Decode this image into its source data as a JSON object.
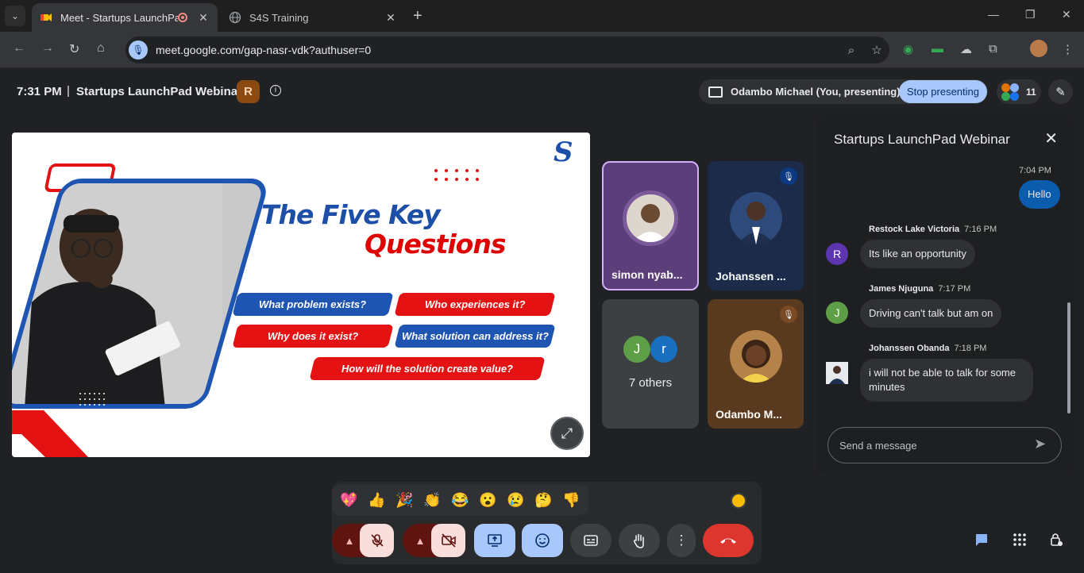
{
  "browser": {
    "tabs": [
      {
        "title": "Meet - Startups LaunchPad",
        "active": true
      },
      {
        "title": "S4S Training",
        "active": false
      }
    ],
    "url": "meet.google.com/gap-nasr-vdk?authuser=0"
  },
  "header": {
    "time": "7:31 PM",
    "separator": "|",
    "meeting_title": "Startups LaunchPad Webinar",
    "host_badge": "R",
    "presenting_label": "Odambo Michael (You, presenting)",
    "stop_presenting": "Stop presenting",
    "participant_count": "11"
  },
  "slide": {
    "title_line1": "The Five Key",
    "title_line2": "Questions",
    "questions": [
      "What problem exists?",
      "Who experiences it?",
      "Why does it exist?",
      "What solution can address it?",
      "How will the solution create value?"
    ]
  },
  "tiles": [
    {
      "name": "simon nyab...",
      "active_speaker": true
    },
    {
      "name": "Johanssen ...",
      "muted": true
    },
    {
      "name": "7 others",
      "letters": [
        "J",
        "r"
      ]
    },
    {
      "name": "Odambo M...",
      "muted": true
    }
  ],
  "chat": {
    "title": "Startups LaunchPad Webinar",
    "messages": [
      {
        "sender": "",
        "time": "7:04 PM",
        "text": "Hello",
        "self": true
      },
      {
        "sender": "Restock Lake Victoria",
        "initial": "R",
        "time": "7:16 PM",
        "text": "Its like an opportunity"
      },
      {
        "sender": "James Njuguna",
        "initial": "J",
        "time": "7:17 PM",
        "text": "Driving can't talk but am on"
      },
      {
        "sender": "Johanssen Obanda",
        "time": "7:18 PM",
        "text": "i will not be able to talk for some minutes"
      }
    ],
    "input_placeholder": "Send a message"
  },
  "reactions": [
    "💖",
    "👍",
    "🎉",
    "👏",
    "😂",
    "😮",
    "😢",
    "🤔",
    "👎"
  ],
  "colors": {
    "accent": "#a8c7fa",
    "hangup": "#dc362e",
    "muted_bg": "#f9dedc",
    "self_bubble": "#0b5cad"
  }
}
